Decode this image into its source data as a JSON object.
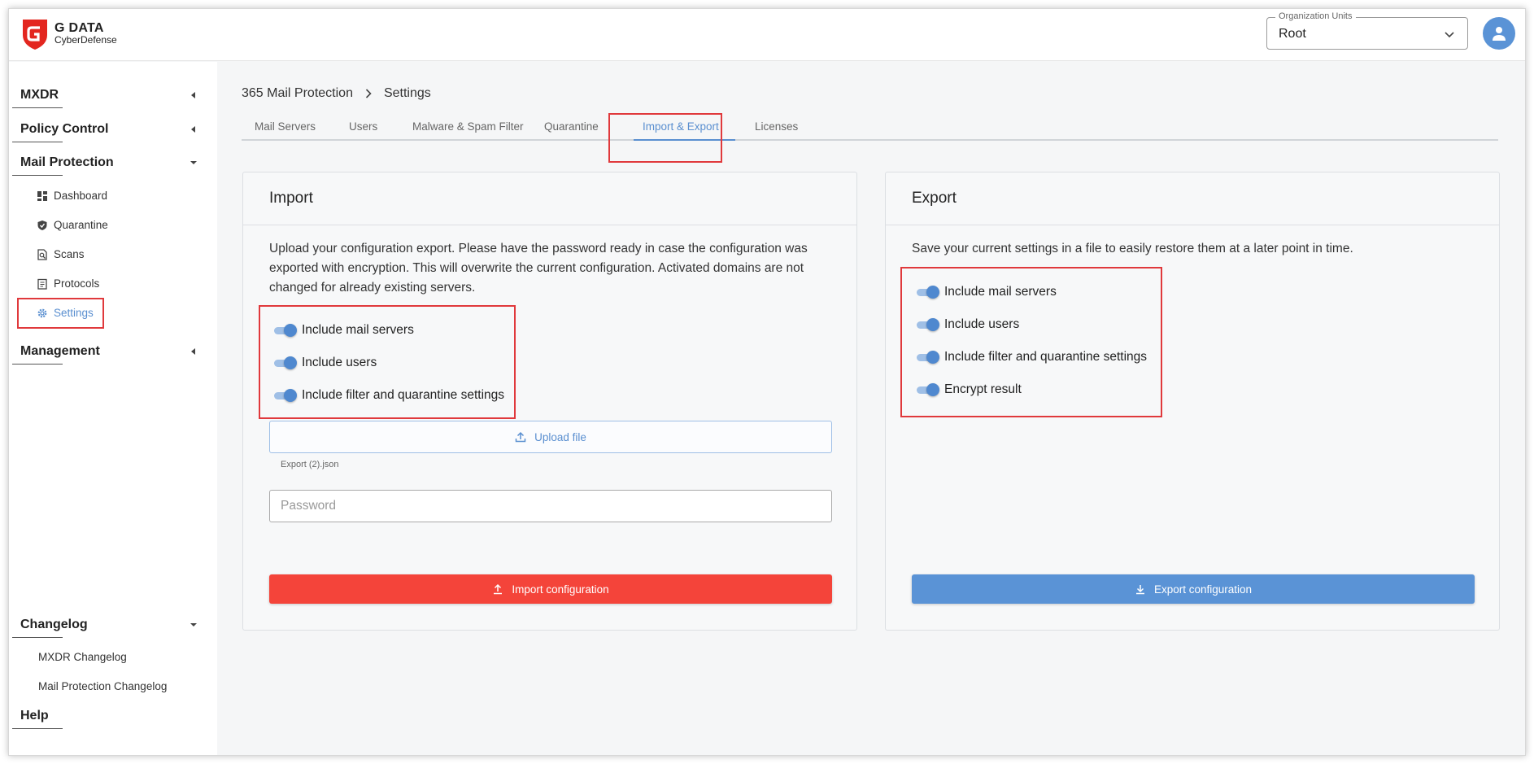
{
  "brand": {
    "line1": "G DATA",
    "line2": "CyberDefense"
  },
  "org": {
    "label": "Organization Units",
    "value": "Root"
  },
  "sidebar": {
    "mxdr": "MXDR",
    "policy": "Policy Control",
    "mail": "Mail Protection",
    "mail_items": [
      {
        "label": "Dashboard",
        "icon": "dashboard-icon"
      },
      {
        "label": "Quarantine",
        "icon": "shield-icon"
      },
      {
        "label": "Scans",
        "icon": "scan-icon"
      },
      {
        "label": "Protocols",
        "icon": "protocol-icon"
      },
      {
        "label": "Settings",
        "icon": "gear-icon"
      }
    ],
    "management": "Management",
    "changelog": "Changelog",
    "changelog_items": [
      "MXDR Changelog",
      "Mail Protection Changelog"
    ],
    "help": "Help"
  },
  "breadcrumb": {
    "root": "365 Mail Protection",
    "current": "Settings"
  },
  "tabs": [
    "Mail Servers",
    "Users",
    "Malware & Spam Filter",
    "Quarantine",
    "Import & Export",
    "Licenses"
  ],
  "active_tab": "Import & Export",
  "import": {
    "title": "Import",
    "desc1": "Upload your configuration export. Please have the password ready in case the configuration was",
    "desc2": "exported with encryption. This will overwrite the current configuration. Activated domains are not",
    "desc3": "changed for already existing servers.",
    "toggles": [
      {
        "label": "Include mail servers",
        "on": true
      },
      {
        "label": "Include users",
        "on": true
      },
      {
        "label": "Include filter and quarantine settings",
        "on": true
      }
    ],
    "upload_label": "Upload file",
    "filename": "Export (2).json",
    "password_placeholder": "Password",
    "button": "Import configuration"
  },
  "export": {
    "title": "Export",
    "desc": "Save your current settings in a file to easily restore them at a later point in time.",
    "toggles": [
      {
        "label": "Include mail servers",
        "on": true
      },
      {
        "label": "Include users",
        "on": true
      },
      {
        "label": "Include filter and quarantine settings",
        "on": true
      },
      {
        "label": "Encrypt result",
        "on": true
      }
    ],
    "button": "Export configuration"
  },
  "colors": {
    "accent": "#5a8fd0",
    "import_button": "#f4443a",
    "export_button": "#5a93d6",
    "highlight": "#e0393c"
  }
}
